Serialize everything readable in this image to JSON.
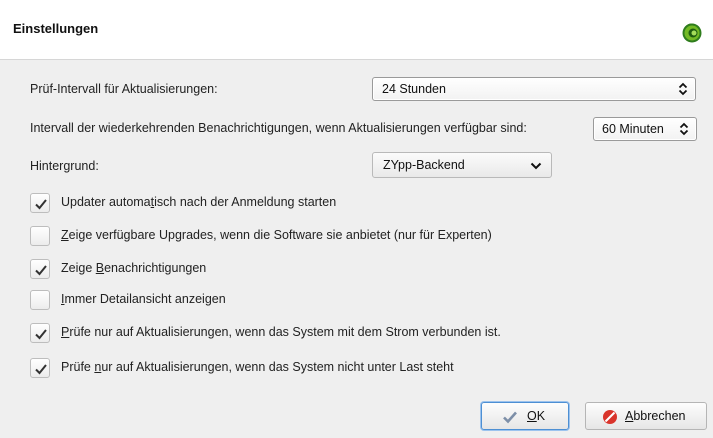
{
  "header": {
    "title": "Einstellungen",
    "icon": "opensuse-gecko-icon"
  },
  "settings": {
    "interval_label": "Prüf-Intervall für Aktualisierungen:",
    "interval_value": "24 Stunden",
    "reminder_label": "Intervall der wiederkehrenden Benachrichtigungen, wenn Aktualisierungen verfügbar sind:",
    "reminder_value": "60 Minuten",
    "backend_label": "Hintergrund:",
    "backend_value": "ZYpp-Backend"
  },
  "options": [
    {
      "pre": "Updater automa",
      "accel": "t",
      "post": "isch nach der Anmeldung starten",
      "checked": true
    },
    {
      "pre": "",
      "accel": "Z",
      "post": "eige verfügbare Upgrades, wenn die Software sie anbietet (nur für Experten)",
      "checked": false
    },
    {
      "pre": "Zeige ",
      "accel": "B",
      "post": "enachrichtigungen",
      "checked": true
    },
    {
      "pre": "",
      "accel": "I",
      "post": "mmer Detailansicht anzeigen",
      "checked": false
    },
    {
      "pre": "",
      "accel": "P",
      "post": "rüfe nur auf Aktualisierungen, wenn das System mit dem Strom verbunden ist.",
      "checked": true
    },
    {
      "pre": "Prüfe ",
      "accel": "n",
      "post": "ur auf Aktualisierungen, wenn das System nicht unter Last steht",
      "checked": true
    }
  ],
  "buttons": {
    "ok_accel": "O",
    "ok_rest": "K",
    "cancel_accel": "A",
    "cancel_rest": "bbrechen"
  },
  "colors": {
    "accent": "#4d8fd3",
    "cancel_red": "#d9342b",
    "gecko_green": "#73ba25"
  }
}
